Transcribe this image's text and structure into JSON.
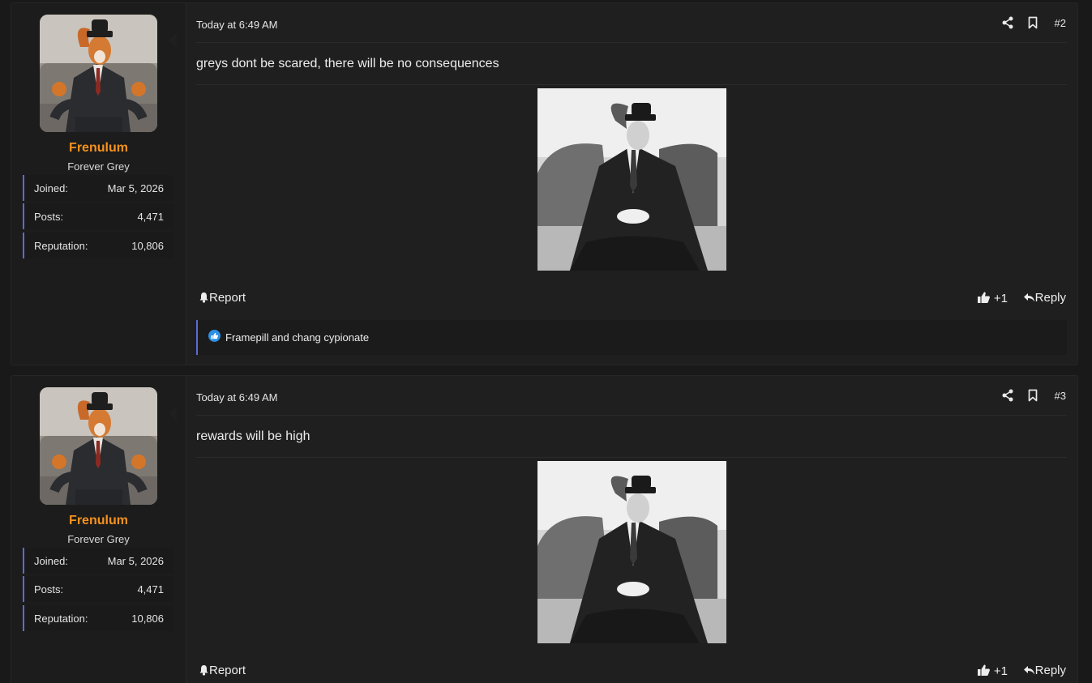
{
  "posts": [
    {
      "user": {
        "avatar_icon": "squirrel-in-suit-avatar",
        "username": "Frenulum",
        "title": "Forever Grey",
        "stats": [
          {
            "label": "Joined:",
            "value": "Mar 5, 2026"
          },
          {
            "label": "Posts:",
            "value": "4,471"
          },
          {
            "label": "Reputation:",
            "value": "10,806"
          }
        ]
      },
      "date": "Today at 6:49 AM",
      "number": "#2",
      "text": "greys dont be scared, there will be no consequences",
      "image_icon": "squirrel-in-suit-photo",
      "actions": {
        "report": "Report",
        "like_count": "+1",
        "reply": "Reply"
      },
      "reactions": "Framepill and chang cypionate"
    },
    {
      "user": {
        "avatar_icon": "squirrel-in-suit-avatar",
        "username": "Frenulum",
        "title": "Forever Grey",
        "stats": [
          {
            "label": "Joined:",
            "value": "Mar 5, 2026"
          },
          {
            "label": "Posts:",
            "value": "4,471"
          },
          {
            "label": "Reputation:",
            "value": "10,806"
          }
        ]
      },
      "date": "Today at 6:49 AM",
      "number": "#3",
      "text": "rewards will be high",
      "image_icon": "squirrel-in-suit-photo",
      "actions": {
        "report": "Report",
        "like_count": "+1",
        "reply": "Reply"
      }
    }
  ],
  "colors": {
    "username": "#f6921e",
    "accent_border": "#5c6bd6",
    "background": "#191919",
    "post_bg": "#1f1f1f"
  }
}
